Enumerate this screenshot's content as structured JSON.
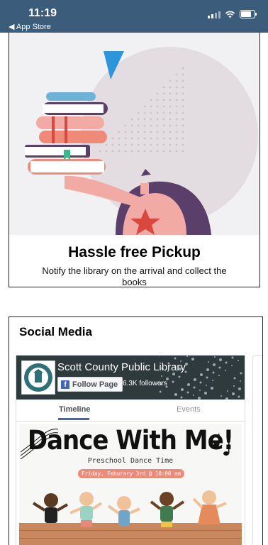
{
  "status_bar": {
    "time": "11:19",
    "back_label": "◀ App Store",
    "background": "#3b5d7b",
    "battery_level": 0.8
  },
  "pickup": {
    "title": "Hassle free Pickup",
    "description": "Notify the library on the arrival and collect the books"
  },
  "social": {
    "title": "Social Media",
    "facebook": {
      "page_name": "Scott County Public Library",
      "follow_label": "Follow Page",
      "followers": "6.3K followers",
      "tabs": [
        {
          "label": "Timeline",
          "active": true
        },
        {
          "label": "Events",
          "active": false
        }
      ],
      "post": {
        "headline": "Dance With Me!",
        "subtitle": "Preschool Dance Time",
        "date": "Friday, Feburary 3rd @ 10:00 am"
      },
      "accent": "#4267b2"
    }
  },
  "icons": {
    "signal": "signal-icon",
    "wifi": "wifi-icon",
    "battery": "battery-icon",
    "facebook": "facebook-icon"
  }
}
